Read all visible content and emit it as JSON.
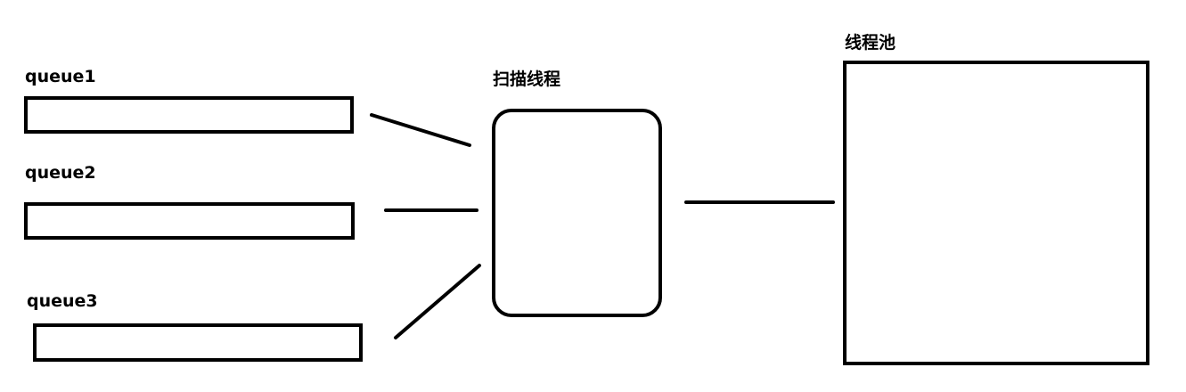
{
  "queues": [
    {
      "label": "queue1"
    },
    {
      "label": "queue2"
    },
    {
      "label": "queue3"
    }
  ],
  "scanner": {
    "label": "扫描线程"
  },
  "pool": {
    "label": "线程池"
  },
  "colors": {
    "stroke": "#000000",
    "background": "#ffffff"
  }
}
